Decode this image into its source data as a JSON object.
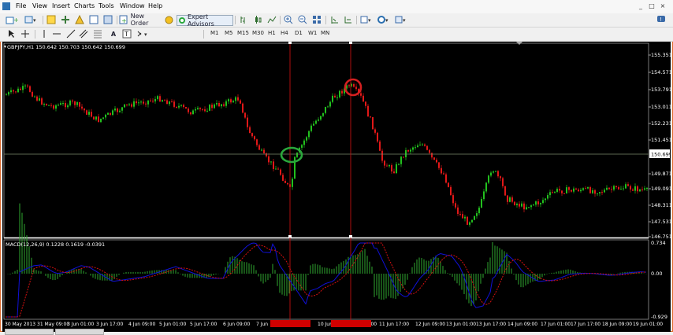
{
  "menu": [
    "File",
    "View",
    "Insert",
    "Charts",
    "Tools",
    "Window",
    "Help"
  ],
  "window_controls": [
    "_",
    "□",
    "×"
  ],
  "toolbar": {
    "new_order": "New Order",
    "expert_advisors": "Expert Advisors",
    "timeframes": [
      "M1",
      "M5",
      "M15",
      "M30",
      "H1",
      "H4",
      "D1",
      "W1",
      "MN"
    ]
  },
  "chart": {
    "symbol_info": "GBPJPY,H1  150.642 150.703 150.642 150.699",
    "price_ticks": [
      "155.351",
      "154.571",
      "153.791",
      "153.011",
      "152.231",
      "151.451",
      "150.699",
      "149.871",
      "149.091",
      "148.311",
      "147.531",
      "146.751"
    ],
    "current_price": "150.699",
    "macd_info": "MACD(12,26,9) 0.1228 0.1619 -0.0391",
    "macd_ticks": [
      "0.734",
      "0.00",
      "-0.929"
    ],
    "time_ticks": [
      "30 May 2013",
      "31 May 09:00",
      "3 Jun 01:00",
      "3 Jun 17:00",
      "4 Jun 09:00",
      "5 Jun 01:00",
      "5 Jun 17:00",
      "6 Jun 09:00",
      "7 Jun",
      "10 Jun",
      "11 Jun 01:00",
      "11 Jun 17:00",
      "12 Jun 09:00",
      "13 Jun 01:00",
      "13 Jun 17:00",
      "14 Jun 09:00",
      "17 Jun 01:00",
      "17 Jun 17:00",
      "18 Jun 09:00",
      "19 Jun 01:00"
    ],
    "colors": {
      "bull": "#22c01e",
      "bear": "#e01818",
      "macd_hist": "#2fa82f",
      "macd_line": "#1010d8",
      "signal_line": "#d81010",
      "grid": "#ffffff",
      "price_line": "#7a8a6a",
      "buy_circle": "#2aa83c",
      "sell_circle": "#d42020",
      "vline": "#c01010",
      "cursor_label": "#d00000"
    }
  }
}
